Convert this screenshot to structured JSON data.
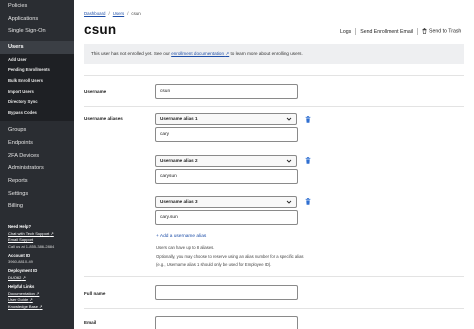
{
  "sidebar": {
    "top_items": [
      {
        "label": "Policies"
      },
      {
        "label": "Applications"
      },
      {
        "label": "Single Sign-On"
      }
    ],
    "users": {
      "label": "Users",
      "sub_items": [
        {
          "label": "Add User"
        },
        {
          "label": "Pending Enrollments"
        },
        {
          "label": "Bulk Enroll Users"
        },
        {
          "label": "Import Users"
        },
        {
          "label": "Directory Sync"
        },
        {
          "label": "Bypass Codes"
        }
      ]
    },
    "bottom_items": [
      {
        "label": "Groups"
      },
      {
        "label": "Endpoints"
      },
      {
        "label": "2FA Devices"
      },
      {
        "label": "Administrators"
      },
      {
        "label": "Reports"
      },
      {
        "label": "Settings"
      },
      {
        "label": "Billing"
      }
    ],
    "help": {
      "need_help": "Need Help?",
      "chat": "Chat with Tech Support",
      "email": "Email Support",
      "call": "Call us at 1-855-386-2884",
      "account_id_label": "Account ID",
      "account_id": "3960-8810-49",
      "deployment_id_label": "Deployment ID",
      "deployment_id": "DUO62",
      "helpful_links_label": "Helpful Links",
      "documentation": "Documentation",
      "user_guide": "User Guide",
      "knowledge_base": "Knowledge Base"
    }
  },
  "breadcrumb": {
    "dashboard": "Dashboard",
    "users": "Users",
    "current": "csun",
    "separator": "/"
  },
  "page_title": "csun",
  "actions": {
    "logs": "Logs",
    "send_enrollment": "Send Enrollment Email",
    "send_trash": "Send to Trash"
  },
  "banner": {
    "prefix": "This user has not enrolled yet. See our ",
    "link": "enrollment documentation",
    "suffix": " to learn more about enrolling users."
  },
  "form": {
    "username_label": "Username",
    "username_value": "csun",
    "aliases_label": "Username aliases",
    "aliases": [
      {
        "select": "Username alias 1",
        "value": "cary"
      },
      {
        "select": "Username alias 2",
        "value": "carysun"
      },
      {
        "select": "Username alias 3",
        "value": "cary.sun"
      }
    ],
    "add_alias": "+ Add a username alias",
    "help_lines": [
      "Users can have up to 8 aliases.",
      "Optionally, you may choose to reserve using an alias number for a specific alias",
      "(e.g., Username alias 1 should only be used for Employee ID)."
    ],
    "full_name_label": "Full name",
    "full_name_value": "",
    "email_label": "Email",
    "email_value": ""
  },
  "colors": {
    "sidebar_bg": "#2a2d32",
    "link_blue": "#1d4ea8",
    "trash_blue": "#2f6fd1"
  }
}
